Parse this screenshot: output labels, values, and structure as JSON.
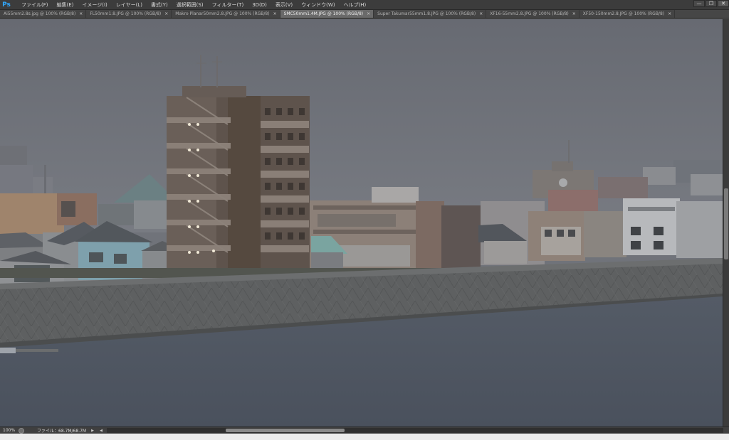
{
  "app": {
    "logo": "Ps",
    "menu": [
      "ファイル(F)",
      "編集(E)",
      "イメージ(I)",
      "レイヤー(L)",
      "書式(Y)",
      "選択範囲(S)",
      "フィルター(T)",
      "3D(D)",
      "表示(V)",
      "ウィンドウ(W)",
      "ヘルプ(H)"
    ],
    "window_controls": {
      "minimize": "—",
      "restore": "❐",
      "close": "✕"
    }
  },
  "tabs": [
    {
      "label": "Ai55mm2.8s.jpg @ 100% (RGB/8)",
      "active": false
    },
    {
      "label": "FL50mm1.8.JPG @ 100% (RGB/8)",
      "active": false
    },
    {
      "label": "Makro Planar50mm2.8.JPG @ 100% (RGB/8)",
      "active": false
    },
    {
      "label": "SMC50mm1.4M.JPG @ 100% (RGB/8)",
      "active": true
    },
    {
      "label": "Super Takumar55mm1.8.JPG @ 100% (RGB/8)",
      "active": false
    },
    {
      "label": "XF16-55mm2.8.JPG @ 100% (RGB/8)",
      "active": false
    },
    {
      "label": "XF50-150mm2.8.JPG @ 100% (RGB/8)",
      "active": false
    }
  ],
  "tab_close_glyph": "×",
  "status": {
    "zoom": "100%",
    "file_info": "ファイル：68.7M/68.7M",
    "arrow_right": "▶",
    "arrow_left": "◀"
  },
  "colors": {
    "sky": "#70737a",
    "water": "#4f5662",
    "seawall": "#5d5f60",
    "tower": "#5a4f49",
    "menubar": "#3c3c3c",
    "active_tab": "#6a6a6a"
  }
}
